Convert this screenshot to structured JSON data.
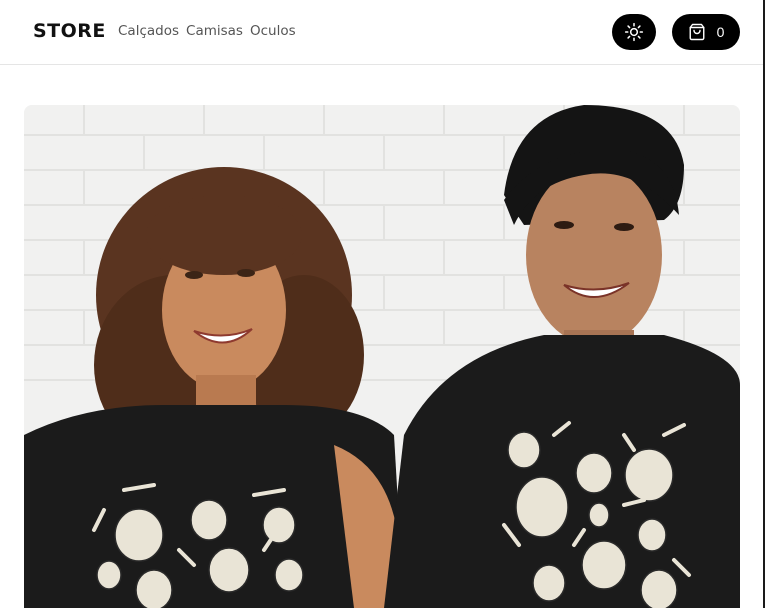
{
  "header": {
    "brand": "STORE",
    "nav": [
      {
        "label": "Calçados"
      },
      {
        "label": "Camisas"
      },
      {
        "label": "Oculos"
      }
    ],
    "theme_toggle_icon": "sun-icon",
    "cart": {
      "icon": "shopping-bag-icon",
      "count": "0"
    }
  },
  "hero": {
    "image_alt": "",
    "accent": "#000000"
  }
}
